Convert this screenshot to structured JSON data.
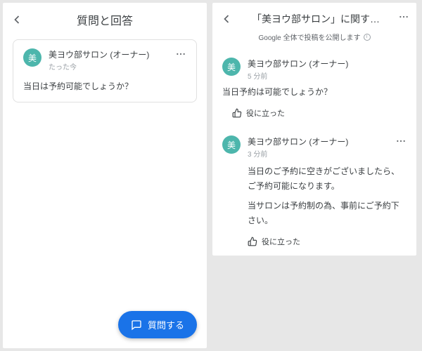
{
  "left": {
    "title": "質問と回答",
    "card": {
      "avatarLetter": "美",
      "author": "美ヨウ部サロン (オーナー)",
      "time": "たった今",
      "body": "当日は予約可能でしょうか？"
    },
    "fabLabel": "質問する"
  },
  "right": {
    "title": "「美ヨウ部サロン」に関す…",
    "subtitle": "Google 全体で投稿を公開します",
    "question": {
      "avatarLetter": "美",
      "author": "美ヨウ部サロン (オーナー)",
      "time": "5 分前",
      "body": "当日予約は可能でしょうか？",
      "helpfulLabel": "役に立った"
    },
    "answer": {
      "avatarLetter": "美",
      "author": "美ヨウ部サロン (オーナー)",
      "time": "3 分前",
      "body1": "当日のご予約に空きがございましたら、ご予約可能になります。",
      "body2": "当サロンは予約制の為、事前にご予約下さい。",
      "helpfulLabel": "役に立った"
    }
  }
}
